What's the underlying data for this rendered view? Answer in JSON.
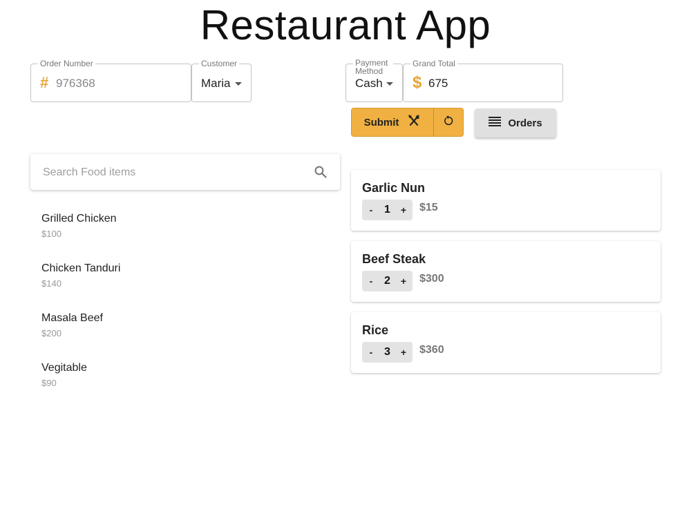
{
  "app": {
    "title": "Restaurant App"
  },
  "order_form": {
    "order_number": {
      "label": "Order Number",
      "prefix": "#",
      "value": "976368"
    },
    "customer": {
      "label": "Customer",
      "value": "Maria"
    },
    "payment_method": {
      "label_line1": "Payment",
      "label_line2": "Method",
      "value": "Cash"
    },
    "grand_total": {
      "label": "Grand Total",
      "prefix": "$",
      "value": "675"
    }
  },
  "actions": {
    "submit_label": "Submit",
    "orders_label": "Orders"
  },
  "search": {
    "placeholder": "Search Food items"
  },
  "food_items": [
    {
      "name": "Grilled Chicken",
      "price": "$100"
    },
    {
      "name": "Chicken Tanduri",
      "price": "$140"
    },
    {
      "name": "Masala Beef",
      "price": "$200"
    },
    {
      "name": "Vegitable",
      "price": "$90"
    }
  ],
  "order_items": [
    {
      "name": "Garlic Nun",
      "qty": "1",
      "price": "$15"
    },
    {
      "name": "Beef Steak",
      "qty": "2",
      "price": "$300"
    },
    {
      "name": "Rice",
      "qty": "3",
      "price": "$360"
    }
  ],
  "qty_controls": {
    "minus": "-",
    "plus": "+"
  },
  "colors": {
    "accent": "#f0b142",
    "prefix": "#e8a536"
  },
  "icons": {
    "submit": "fork-knife-icon",
    "reset": "refresh-icon",
    "orders": "list-icon",
    "search": "search-icon",
    "dropdown": "arrow-drop-down-icon"
  }
}
